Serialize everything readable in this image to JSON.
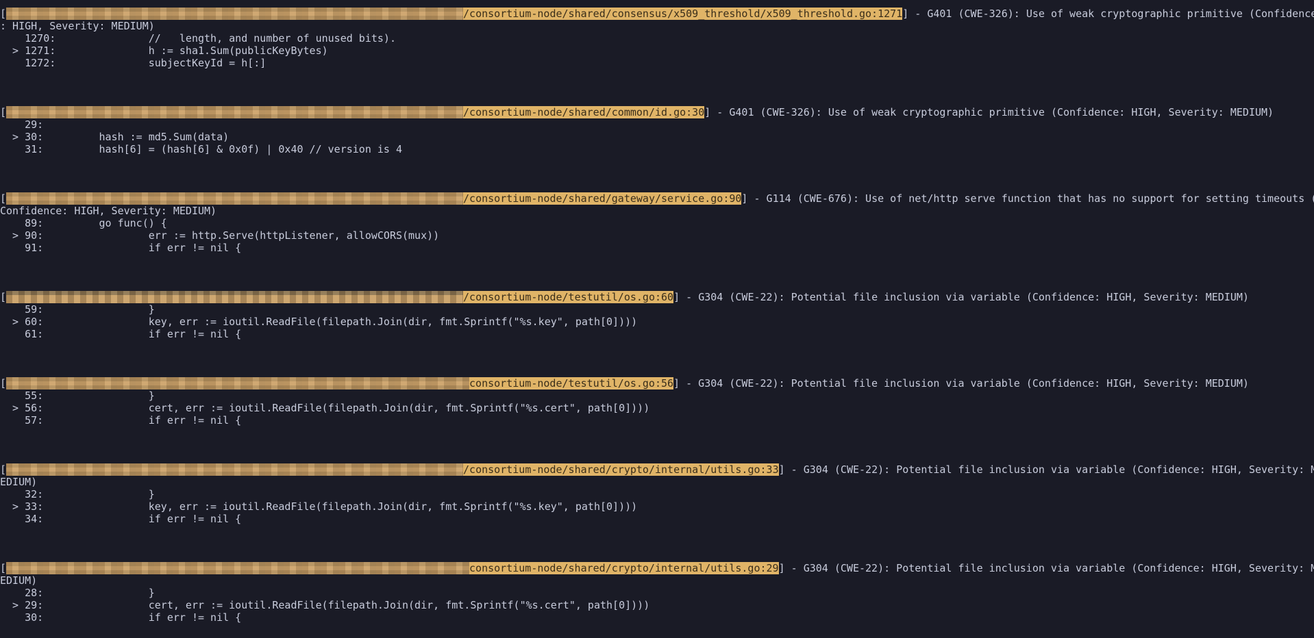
{
  "terminal": {
    "blocks": [
      {
        "open_bracket": "[",
        "path": "/consortium-node/shared/consensus/x509_threshold/x509_threshold.go:1271",
        "message": "] - G401 (CWE-326): Use of weak cryptographic primitive (Confidence",
        "wrap": ": HIGH, Severity: MEDIUM)",
        "lines": [
          "    1270:               //   length, and number of unused bits).",
          "  > 1271:               h := sha1.Sum(publicKeyBytes)",
          "    1272:               subjectKeyId = h[:]"
        ]
      },
      {
        "open_bracket": "[",
        "path": "/consortium-node/shared/common/id.go:30",
        "message": "] - G401 (CWE-326): Use of weak cryptographic primitive (Confidence: HIGH, Severity: MEDIUM)",
        "wrap": "",
        "lines": [
          "    29:",
          "  > 30:         hash := md5.Sum(data)",
          "    31:         hash[6] = (hash[6] & 0x0f) | 0x40 // version is 4"
        ]
      },
      {
        "open_bracket": "[",
        "path": "/consortium-node/shared/gateway/service.go:90",
        "message": "] - G114 (CWE-676): Use of net/http serve function that has no support for setting timeouts (",
        "wrap": "Confidence: HIGH, Severity: MEDIUM)",
        "lines": [
          "    89:         go func() {",
          "  > 90:                 err := http.Serve(httpListener, allowCORS(mux))",
          "    91:                 if err != nil {"
        ]
      },
      {
        "open_bracket": "[",
        "path": "/consortium-node/testutil/os.go:60",
        "message": "] - G304 (CWE-22): Potential file inclusion via variable (Confidence: HIGH, Severity: MEDIUM)",
        "wrap": "",
        "lines": [
          "    59:                 }",
          "  > 60:                 key, err := ioutil.ReadFile(filepath.Join(dir, fmt.Sprintf(\"%s.key\", path[0])))",
          "    61:                 if err != nil {"
        ]
      },
      {
        "open_bracket": "[",
        "path": "consortium-node/testutil/os.go:56",
        "message": "] - G304 (CWE-22): Potential file inclusion via variable (Confidence: HIGH, Severity: MEDIUM)",
        "wrap": "",
        "lines": [
          "    55:                 }",
          "  > 56:                 cert, err := ioutil.ReadFile(filepath.Join(dir, fmt.Sprintf(\"%s.cert\", path[0])))",
          "    57:                 if err != nil {"
        ]
      },
      {
        "open_bracket": "[",
        "path": "/consortium-node/shared/crypto/internal/utils.go:33",
        "message": "] - G304 (CWE-22): Potential file inclusion via variable (Confidence: HIGH, Severity: M",
        "wrap": "EDIUM)",
        "lines": [
          "    32:                 }",
          "  > 33:                 key, err := ioutil.ReadFile(filepath.Join(dir, fmt.Sprintf(\"%s.key\", path[0])))",
          "    34:                 if err != nil {"
        ]
      },
      {
        "open_bracket": "[",
        "path": "consortium-node/shared/crypto/internal/utils.go:29",
        "message": "] - G304 (CWE-22): Potential file inclusion via variable (Confidence: HIGH, Severity: M",
        "wrap": "EDIUM)",
        "lines": [
          "    28:                 }",
          "  > 29:                 cert, err := ioutil.ReadFile(filepath.Join(dir, fmt.Sprintf(\"%s.cert\", path[0])))",
          "    30:                 if err != nil {"
        ]
      }
    ]
  }
}
